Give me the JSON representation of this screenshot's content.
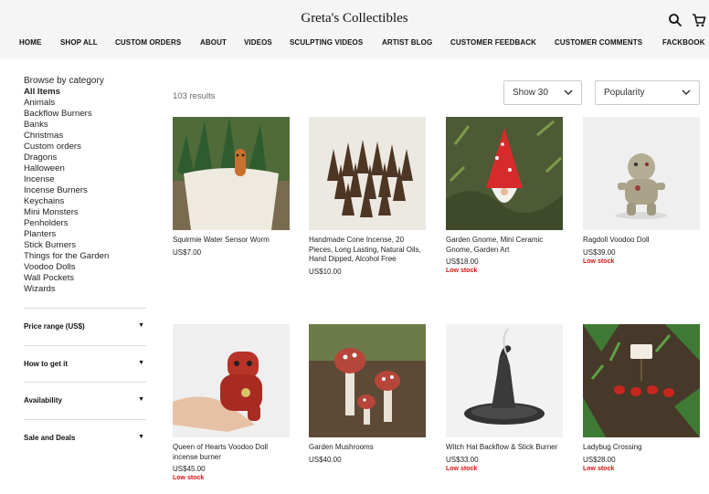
{
  "site": {
    "title": "Greta's Collectibles"
  },
  "nav": {
    "items": [
      "HOME",
      "SHOP ALL",
      "CUSTOM ORDERS",
      "ABOUT",
      "VIDEOS",
      "SCULPTING VIDEOS",
      "ARTIST BLOG",
      "CUSTOMER FEEDBACK",
      "CUSTOMER COMMENTS",
      "FACKBOOK"
    ]
  },
  "sidebar": {
    "heading": "Browse by category",
    "categories": [
      "All Items",
      "Animals",
      "Backflow Burners",
      "Banks",
      "Christmas",
      "Custom orders",
      "Dragons",
      "Halloween",
      "Incense",
      "Incense Burners",
      "Keychains",
      "Mini Monsters",
      "Penholders",
      "Planters",
      "Stick Burners",
      "Things for the Garden",
      "Voodoo Dolls",
      "Wall Pockets",
      "Wizards"
    ],
    "active_category": "All Items",
    "filters": [
      "Price range (US$)",
      "How to get it",
      "Availability",
      "Sale and Deals"
    ]
  },
  "toolbar": {
    "results": "103 results",
    "show": "Show 30",
    "sort": "Popularity"
  },
  "products": [
    {
      "title": "Squirmie Water Sensor Worm",
      "price": "US$7.00",
      "stock": ""
    },
    {
      "title": "Handmade Cone Incense, 20 Pieces, Long Lasting, Natural Oils, Hand Dipped, Alcohol Free",
      "price": "US$10.00",
      "stock": ""
    },
    {
      "title": "Garden Gnome, Mini Ceramic Gnome, Garden Art",
      "price": "US$18.00",
      "stock": "Low stock"
    },
    {
      "title": "Ragdoll Voodoo Doll",
      "price": "US$39.00",
      "stock": "Low stock"
    },
    {
      "title": "Queen of Hearts Voodoo Doll incense burner",
      "price": "US$45.00",
      "stock": "Low stock"
    },
    {
      "title": "Garden Mushrooms",
      "price": "US$40.00",
      "stock": ""
    },
    {
      "title": "Witch Hat Backflow & Stick Burner",
      "price": "US$33.00",
      "stock": "Low stock"
    },
    {
      "title": "Ladybug Crossing",
      "price": "US$28.00",
      "stock": "Low stock"
    }
  ],
  "icons": {
    "search": "search-icon",
    "cart": "cart-icon",
    "caret": "chevron-down-icon"
  },
  "colors": {
    "header_bg": "#f5f5f5",
    "low_stock": "#dd1111"
  }
}
